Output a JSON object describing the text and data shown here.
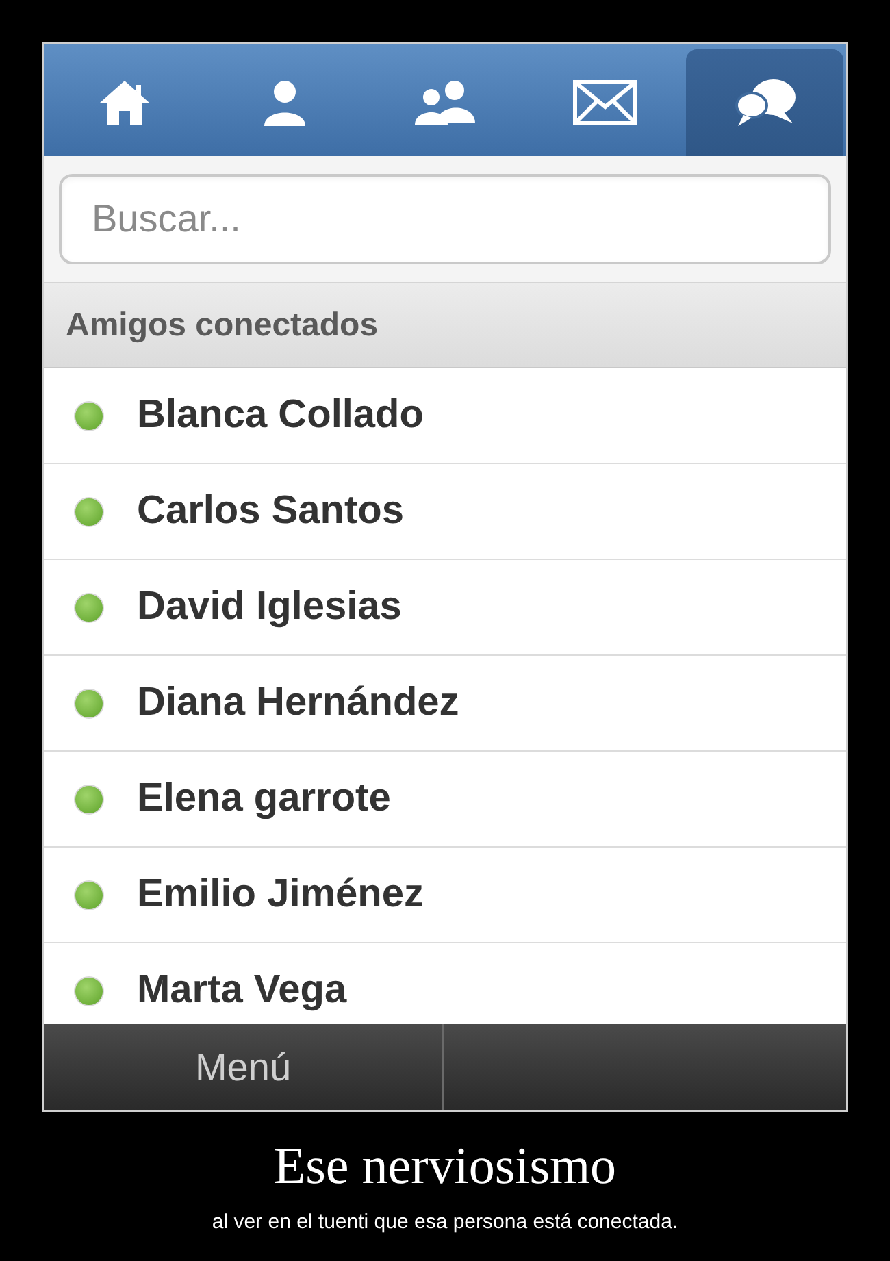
{
  "tabs": [
    {
      "kind": "home",
      "selected": false
    },
    {
      "kind": "person",
      "selected": false
    },
    {
      "kind": "people",
      "selected": false
    },
    {
      "kind": "mail",
      "selected": false
    },
    {
      "kind": "chat",
      "selected": true
    }
  ],
  "search": {
    "placeholder": "Buscar..."
  },
  "section_header": "Amigos conectados",
  "friends": [
    {
      "name": "Blanca Collado",
      "online": true
    },
    {
      "name": "Carlos Santos",
      "online": true
    },
    {
      "name": "David Iglesias",
      "online": true
    },
    {
      "name": "Diana Hernández",
      "online": true
    },
    {
      "name": "Elena garrote",
      "online": true
    },
    {
      "name": "Emilio Jiménez",
      "online": true
    },
    {
      "name": "Marta Vega",
      "online": true
    }
  ],
  "bottom_bar": {
    "menu_label": "Menú"
  },
  "caption": {
    "title": "Ese nerviosismo",
    "subtitle": "al ver en el tuenti que esa persona está conectada."
  }
}
